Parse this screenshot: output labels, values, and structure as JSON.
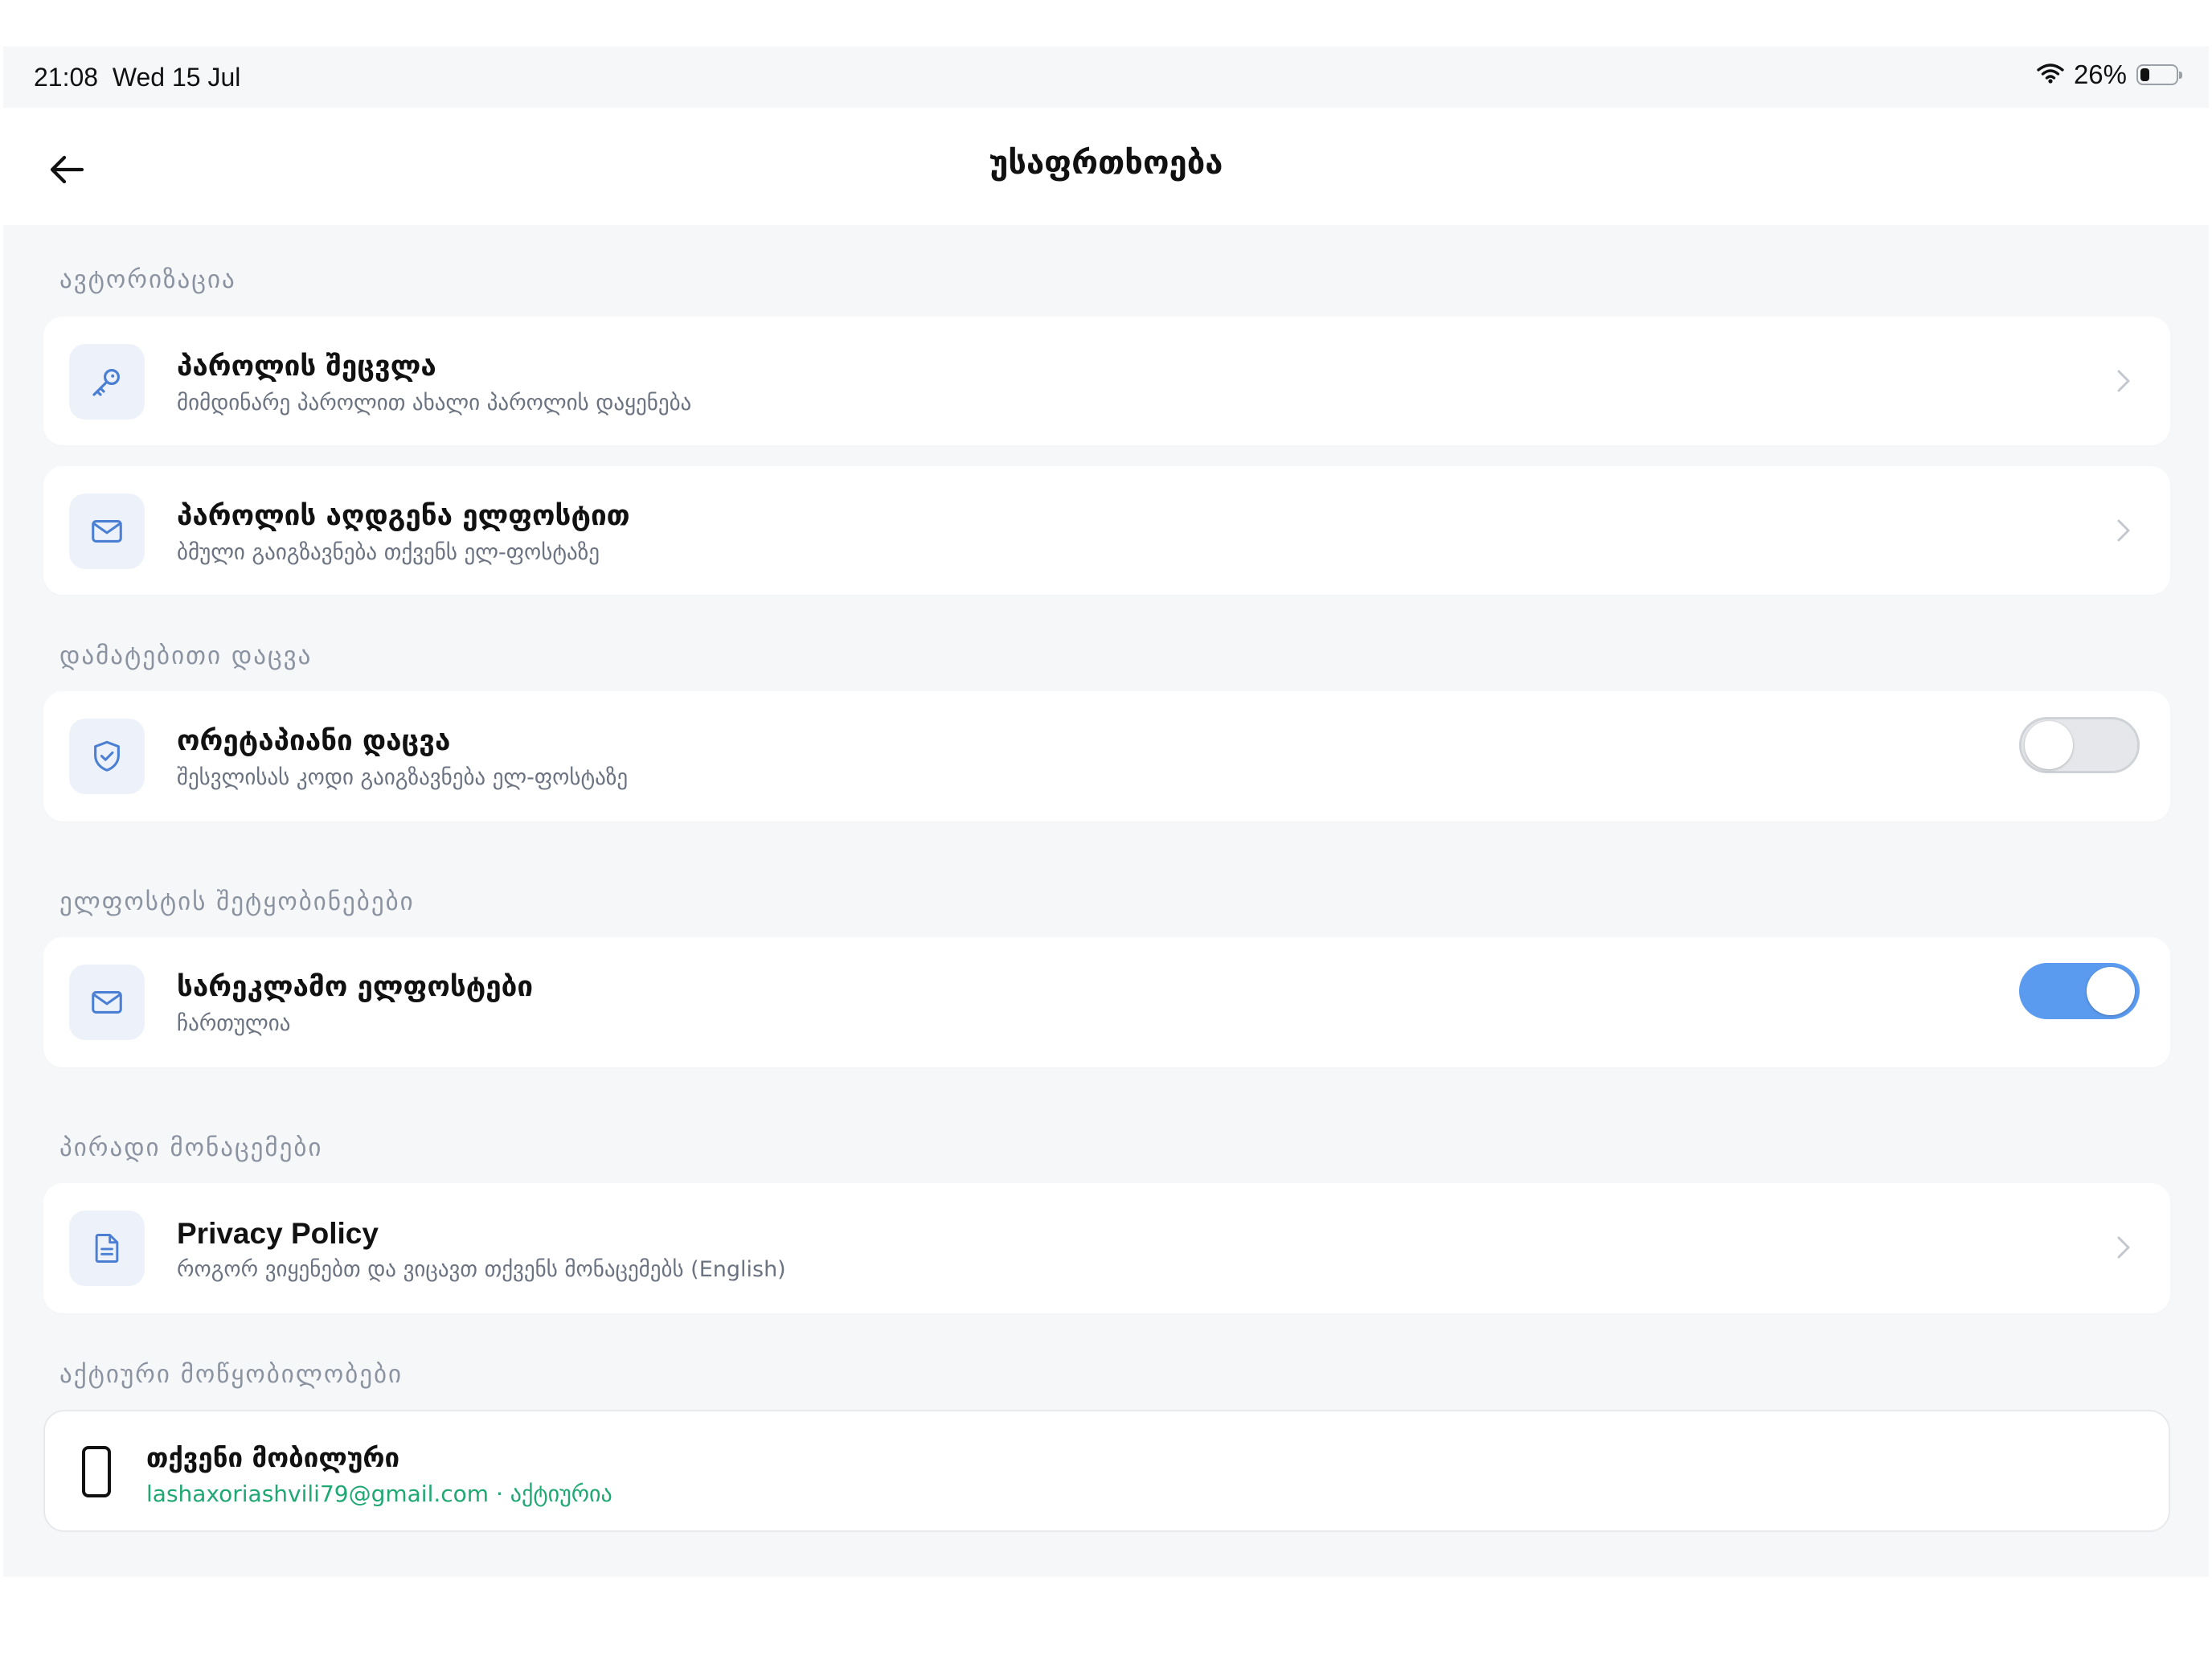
{
  "status_bar": {
    "time": "21:08  Wed 15 Jul",
    "battery_percent": "26%",
    "battery_level": 0.26
  },
  "header": {
    "title": "უსაფრთხოება",
    "back_icon": "arrow-left-icon"
  },
  "sections": {
    "auth": {
      "title": "ავტორიზაცია",
      "items": [
        {
          "title": "პაროლის შეცვლა",
          "subtitle": "მიმდინარე პაროლით ახალი პაროლის დაყენება",
          "icon": "key-icon"
        },
        {
          "title": "პაროლის აღდგენა ელფოსტით",
          "subtitle": "ბმული გაიგზავნება თქვენს ელ-ფოსტაზე",
          "icon": "mail-icon"
        }
      ]
    },
    "extra": {
      "title": "დამატებითი დაცვა",
      "item": {
        "title": "ორეტაპიანი დაცვა",
        "subtitle": "შესვლისას კოდი გაიგზავნება ელ-ფოსტაზე",
        "icon": "shield-check-icon",
        "enabled": false
      }
    },
    "email": {
      "title": "ელფოსტის შეტყობინებები",
      "item": {
        "title": "სარეკლამო ელფოსტები",
        "subtitle": "ჩართულია",
        "icon": "mail-icon",
        "enabled": true
      }
    },
    "privacy": {
      "title": "პირადი მონაცემები",
      "item": {
        "title": "Privacy Policy",
        "subtitle": "როგორ ვიყენებთ და ვიცავთ თქვენს მონაცემებს (English)",
        "icon": "document-icon"
      }
    },
    "devices": {
      "title": "აქტიური მოწყობილობები",
      "item": {
        "name": "თქვენი მობილური",
        "subtitle": "lashaxoriashvili79@gmail.com · აქტიურია",
        "icon": "phone-icon"
      }
    }
  },
  "colors": {
    "background": "#f6f7f9",
    "card": "#ffffff",
    "section_title": "#8b93a1",
    "icon_bg": "#edf2fa",
    "icon_blue": "#4a7fd4",
    "toggle_on": "#5b9bef",
    "active_green": "#1fa873"
  }
}
